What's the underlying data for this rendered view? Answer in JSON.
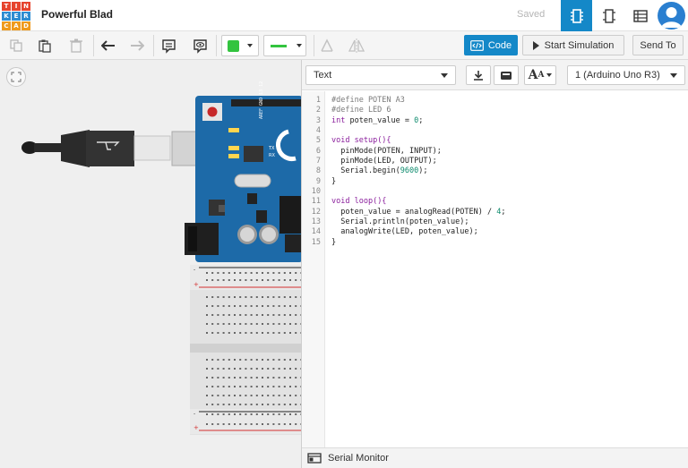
{
  "app": {
    "logo_letters": [
      "T",
      "I",
      "N",
      "K",
      "E",
      "R",
      "C",
      "A",
      "D"
    ],
    "logo_colors": [
      "#e6432d",
      "#e6432d",
      "#e6432d",
      "#2d8cd1",
      "#2d8cd1",
      "#2d8cd1",
      "#ef9a1c",
      "#ef9a1c",
      "#ef9a1c"
    ],
    "project_title": "Powerful Blad",
    "save_status": "Saved",
    "accent_color": "#1488c8"
  },
  "toolbar": {
    "code_label": "Code",
    "start_sim_label": "Start Simulation",
    "send_to_label": "Send To",
    "fill_color": "#33c43f",
    "line_color": "#33c43f"
  },
  "code_panel": {
    "mode_value": "Text",
    "board_value": "1 (Arduino Uno R3)",
    "font_button_label": "A",
    "line_numbers": [
      "1",
      "2",
      "3",
      "4",
      "5",
      "6",
      "7",
      "8",
      "9",
      "10",
      "11",
      "12",
      "13",
      "14",
      "15"
    ],
    "lines": [
      [
        {
          "t": "#define POTEN A3",
          "c": "pre"
        }
      ],
      [
        {
          "t": "#define LED 6",
          "c": "pre"
        }
      ],
      [
        {
          "t": "int",
          "c": "kw"
        },
        {
          "t": " poten_value = ",
          "c": ""
        },
        {
          "t": "0",
          "c": "num"
        },
        {
          "t": ";",
          "c": ""
        }
      ],
      [
        {
          "t": "",
          "c": ""
        }
      ],
      [
        {
          "t": "void",
          "c": "kw"
        },
        {
          "t": " setup(){",
          "c": "kw"
        }
      ],
      [
        {
          "t": "  pinMode(POTEN, INPUT);",
          "c": ""
        }
      ],
      [
        {
          "t": "  pinMode(LED, OUTPUT);",
          "c": ""
        }
      ],
      [
        {
          "t": "  Serial.begin(",
          "c": ""
        },
        {
          "t": "9600",
          "c": "num"
        },
        {
          "t": ");",
          "c": ""
        }
      ],
      [
        {
          "t": "}",
          "c": ""
        }
      ],
      [
        {
          "t": "",
          "c": ""
        }
      ],
      [
        {
          "t": "void",
          "c": "kw"
        },
        {
          "t": " loop(){",
          "c": "kw"
        }
      ],
      [
        {
          "t": "  poten_value = analogRead(POTEN) / ",
          "c": ""
        },
        {
          "t": "4",
          "c": "num"
        },
        {
          "t": ";",
          "c": ""
        }
      ],
      [
        {
          "t": "  Serial.println(poten_value);",
          "c": ""
        }
      ],
      [
        {
          "t": "  analogWrite(LED, poten_value);",
          "c": ""
        }
      ],
      [
        {
          "t": "}",
          "c": ""
        }
      ]
    ]
  },
  "serial_monitor": {
    "label": "Serial Monitor"
  }
}
